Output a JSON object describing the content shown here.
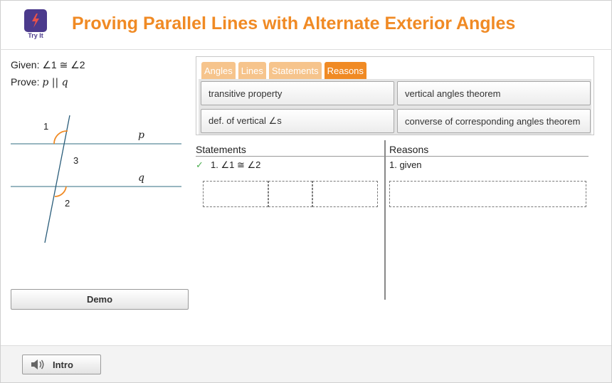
{
  "header": {
    "title": "Proving Parallel Lines with Alternate Exterior Angles",
    "logo_label": "Try It",
    "logo_icon": "lightning-bolt-icon",
    "logo_color": "#4b3a8c",
    "accent_color": "#f08a24"
  },
  "problem": {
    "given_label": "Given: ",
    "given_math": "∠1 ≅ ∠2",
    "prove_label": "Prove: ",
    "prove_math": "p || q"
  },
  "diagram": {
    "angle1": "1",
    "angle2": "2",
    "angle3": "3",
    "line_p": "p",
    "line_q": "q"
  },
  "demo_button": "Demo",
  "bank": {
    "tabs": [
      {
        "label": "Angles",
        "active": false
      },
      {
        "label": "Lines",
        "active": false
      },
      {
        "label": "Statements",
        "active": false
      },
      {
        "label": "Reasons",
        "active": true
      }
    ],
    "tiles": [
      {
        "label": "transitive property"
      },
      {
        "label": "vertical angles theorem"
      },
      {
        "label": "def. of vertical ∠s"
      },
      {
        "label": "converse of corresponding angles theorem"
      }
    ]
  },
  "proof": {
    "statements_header": "Statements",
    "reasons_header": "Reasons",
    "rows": [
      {
        "check": "✓",
        "statement": "1. ∠1 ≅ ∠2",
        "reason": "1. given"
      }
    ]
  },
  "footer": {
    "intro_button": "Intro",
    "intro_icon": "speaker-icon"
  }
}
